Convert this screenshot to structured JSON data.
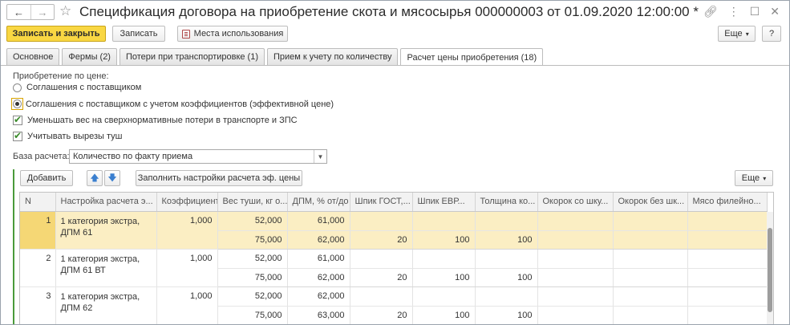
{
  "title": "Спецификация договора на приобретение скота и мясосырья 000000003 от 01.09.2020 12:00:00 *",
  "toolbar": {
    "save_close": "Записать и закрыть",
    "save": "Записать",
    "usages": "Места использования",
    "more": "Еще",
    "more_arrow": "▾",
    "help": "?"
  },
  "tabs": [
    "Основное",
    "Фермы (2)",
    "Потери при транспортировке (1)",
    "Прием к учету по количеству",
    "Расчет цены приобретения (18)"
  ],
  "form": {
    "pricing_label": "Приобретение по цене:",
    "opt1": "Соглашения с поставщиком",
    "opt2": "Соглашения с поставщиком с учетом коэффициентов (эффективной цене)",
    "chk1": "Уменьшать вес на сверхнормативные потери в транспорте и ЗПС",
    "chk2": "Учитывать вырезы туш",
    "base_label": "База расчета:",
    "base_value": "Количество по факту приема"
  },
  "table_toolbar": {
    "add": "Добавить",
    "fill": "Заполнить настройки расчета эф. цены",
    "more": "Еще",
    "more_arrow": "▾"
  },
  "table": {
    "headers": [
      "N",
      "Настройка расчета э...",
      "Коэффициент",
      "Вес туши, кг о...",
      "ДПМ, % от/до",
      "Шпик ГОСТ,...",
      "Шпик ЕВР...",
      "Толщина ко...",
      "Окорок со шку...",
      "Окорок без шк...",
      "Мясо филейно..."
    ],
    "groups": [
      {
        "n": "1",
        "name1": "1 категория экстра,",
        "name2": "ДПМ 61",
        "coef": "1,000",
        "r1": {
          "w": "52,000",
          "dpm": "61,000",
          "a": "",
          "b": "",
          "c": ""
        },
        "r2": {
          "w": "75,000",
          "dpm": "62,000",
          "a": "20",
          "b": "100",
          "c": "100"
        }
      },
      {
        "n": "2",
        "name1": "1 категория экстра,",
        "name2": "ДПМ 61 ВТ",
        "coef": "1,000",
        "r1": {
          "w": "52,000",
          "dpm": "61,000",
          "a": "",
          "b": "",
          "c": ""
        },
        "r2": {
          "w": "75,000",
          "dpm": "62,000",
          "a": "20",
          "b": "100",
          "c": "100"
        }
      },
      {
        "n": "3",
        "name1": "1 категория экстра,",
        "name2": "ДПМ 62",
        "coef": "1,000",
        "r1": {
          "w": "52,000",
          "dpm": "62,000",
          "a": "",
          "b": "",
          "c": ""
        },
        "r2": {
          "w": "75,000",
          "dpm": "63,000",
          "a": "20",
          "b": "100",
          "c": "100"
        }
      }
    ]
  }
}
